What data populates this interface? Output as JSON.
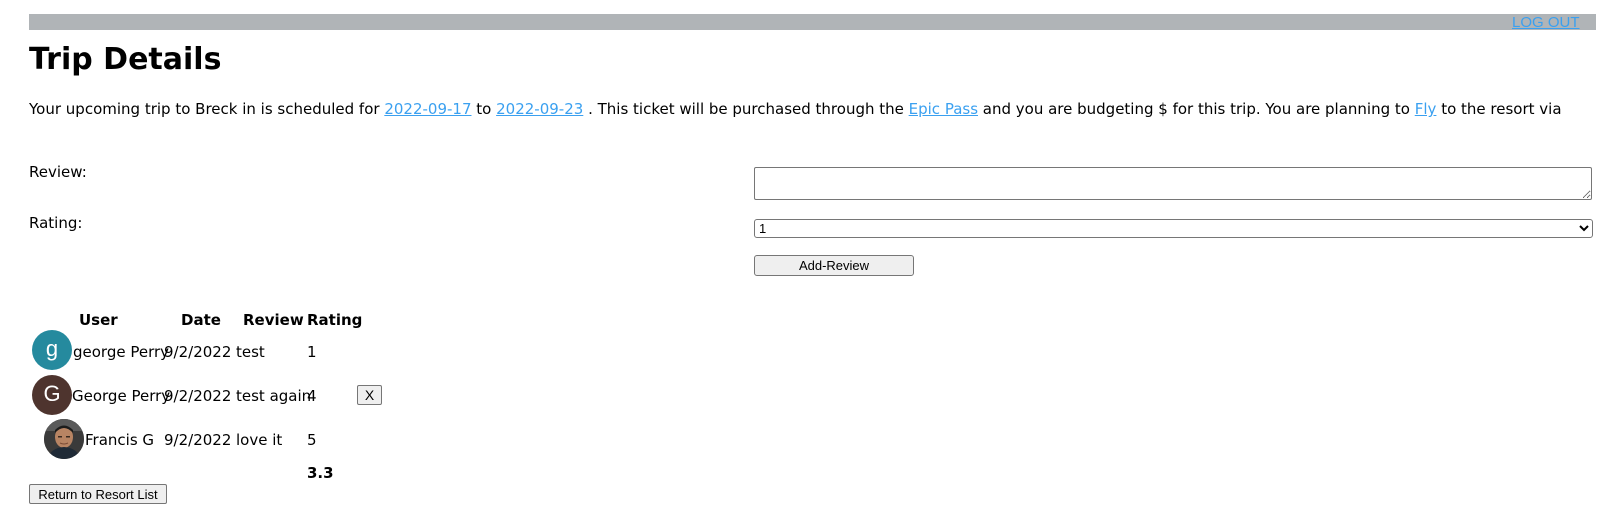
{
  "header": {
    "logout_label": "LOG OUT"
  },
  "page": {
    "title": "Trip Details",
    "intro": {
      "part1": "Your upcoming trip to Breck in is scheduled for ",
      "start_date": "2022-09-17",
      "part2": " to ",
      "end_date": "2022-09-23",
      "part3": " . This ticket will be purchased through the ",
      "pass": "Epic Pass",
      "part4": " and you are budgeting $ for this trip. You are planning to ",
      "travel": "Fly",
      "part5": " to the resort via"
    }
  },
  "form": {
    "review_label": "Review:",
    "review_value": "",
    "rating_label": "Rating:",
    "rating_selected": "1",
    "add_button": "Add-Review"
  },
  "reviews": {
    "headers": {
      "user": "User",
      "date": "Date",
      "review": "Review",
      "rating": "Rating"
    },
    "rows": [
      {
        "avatar_letter": "g",
        "avatar_color": "#258a9e",
        "user": "george Perry",
        "date": "9/2/2022",
        "review": "test",
        "rating": "1"
      },
      {
        "avatar_letter": "G",
        "avatar_color": "#4e342e",
        "user": "George Perry",
        "date": "9/2/2022",
        "review": "test again",
        "rating": "4",
        "delete_label": "X"
      },
      {
        "avatar_icon": "user-photo-icon",
        "user": "Francis G",
        "date": "9/2/2022",
        "review": "love it",
        "rating": "5"
      }
    ],
    "average": "3.3"
  },
  "footer": {
    "return_button": "Return to Resort List"
  },
  "colors": {
    "link": "#3aa0f0",
    "topbar": "#b0b4b7"
  }
}
